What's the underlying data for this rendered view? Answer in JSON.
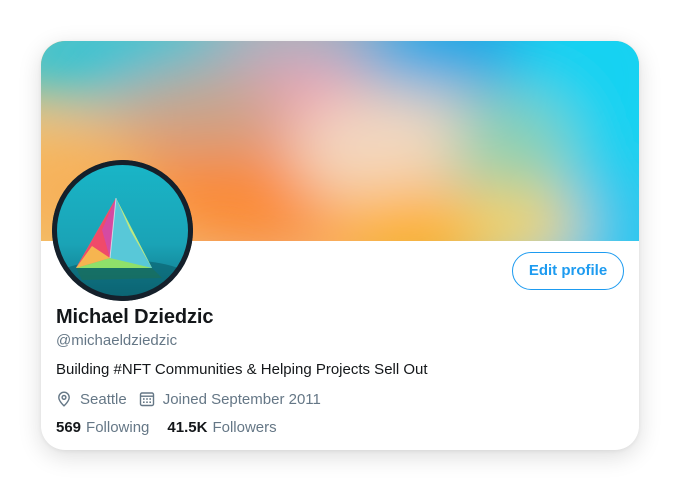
{
  "profile": {
    "name": "Michael Dziedzic",
    "handle": "@michaeldziedzic",
    "bio": "Building #NFT Communities & Helping Projects Sell Out",
    "location": "Seattle",
    "joined": "Joined September 2011",
    "edit_label": "Edit profile"
  },
  "stats": {
    "following_count": "569",
    "following_label": "Following",
    "followers_count": "41.5K",
    "followers_label": "Followers"
  },
  "icons": {
    "location": "location-pin-icon",
    "joined": "calendar-icon"
  },
  "colors": {
    "accent": "#1d9bf0",
    "name": "#14171a",
    "secondary": "#657786"
  }
}
